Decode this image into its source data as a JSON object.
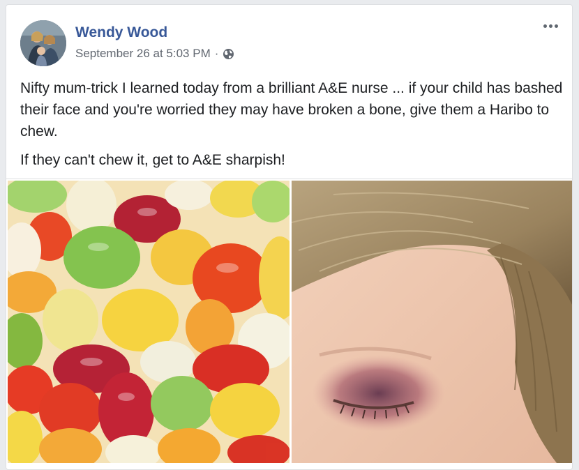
{
  "post": {
    "author": "Wendy Wood",
    "date": "September 26 at 5:03 PM",
    "separator": "·",
    "privacy_icon": "globe-icon",
    "more_icon": "more-options-icon",
    "paragraphs": [
      "Nifty mum-trick I learned today from a brilliant A&E nurse ... if your child has bashed their face and you're worried they may have broken a bone, give them a Haribo to chew.",
      "If they can't chew it, get to A&E sharpish!"
    ]
  },
  "photos": [
    {
      "subject": "gummy-bears-photo"
    },
    {
      "subject": "child-bruised-eye-photo"
    }
  ],
  "colors": {
    "author_link": "#385898",
    "meta_text": "#616770",
    "body_text": "#1c1e21",
    "background": "#e9ebee",
    "card": "#ffffff"
  }
}
